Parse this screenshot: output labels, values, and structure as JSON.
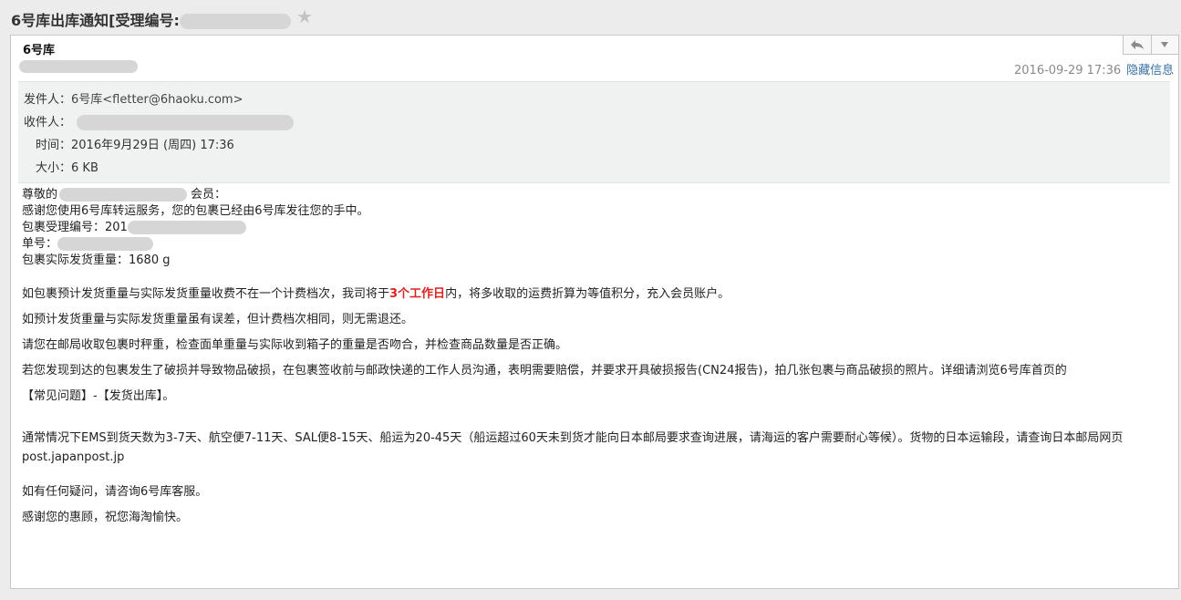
{
  "header": {
    "subject": "6号库出库通知[受理编号:",
    "star_icon": "star-icon"
  },
  "message": {
    "sender_name": "6号库",
    "date": "2016-09-29 17:36",
    "hide_info_label": "隐藏信息",
    "reply_icon": "reply-icon",
    "more_icon": "chevron-down-icon"
  },
  "meta": {
    "from_label": "发件人：",
    "from_value": "6号库<fletter@6haoku.com>",
    "to_label": "收件人：",
    "time_label": "时间：",
    "time_value": "2016年9月29日 (周四) 17:36",
    "size_label": "大小：",
    "size_value": "6 KB"
  },
  "body": {
    "greeting_prefix": "尊敬的",
    "greeting_suffix": "会员：",
    "line_thanks": "感谢您使用6号库转运服务，您的包裹已经由6号库发往您的手中。",
    "line_accept_no": "包裹受理编号：201",
    "line_tracking_no": "单号：",
    "line_weight": "包裹实际发货重量：1680 g",
    "para1_before": "如包裹预计发货重量与实际发货重量收费不在一个计费档次，我司将于",
    "para1_highlight": "3个工作日",
    "para1_after": "内，将多收取的运费折算为等值积分，充入会员账户。",
    "para2": "如预计发货重量与实际发货重量虽有误差，但计费档次相同，则无需退还。",
    "para3": "请您在邮局收取包裹时秤重，检查面单重量与实际收到箱子的重量是否吻合，并检查商品数量是否正确。",
    "para4": "若您发现到达的包裹发生了破损并导致物品破损，在包裹签收前与邮政快递的工作人员沟通，表明需要赔偿，并要求开具破损报告(CN24报告)，拍几张包裹与商品破损的照片。详细请浏览6号库首页的",
    "para4_links": "【常见问题】-【发货出库】。",
    "para5": "通常情况下EMS到货天数为3-7天、航空便7-11天、SAL便8-15天、船运为20-45天（船运超过60天未到货才能向日本邮局要求查询进展，请海运的客户需要耐心等候）。货物的日本运输段，请查询日本邮局网页 post.japanpost.jp",
    "para6": "如有任何疑问，请咨询6号库客服。",
    "para7": "感谢您的惠顾，祝您海淘愉快。"
  }
}
